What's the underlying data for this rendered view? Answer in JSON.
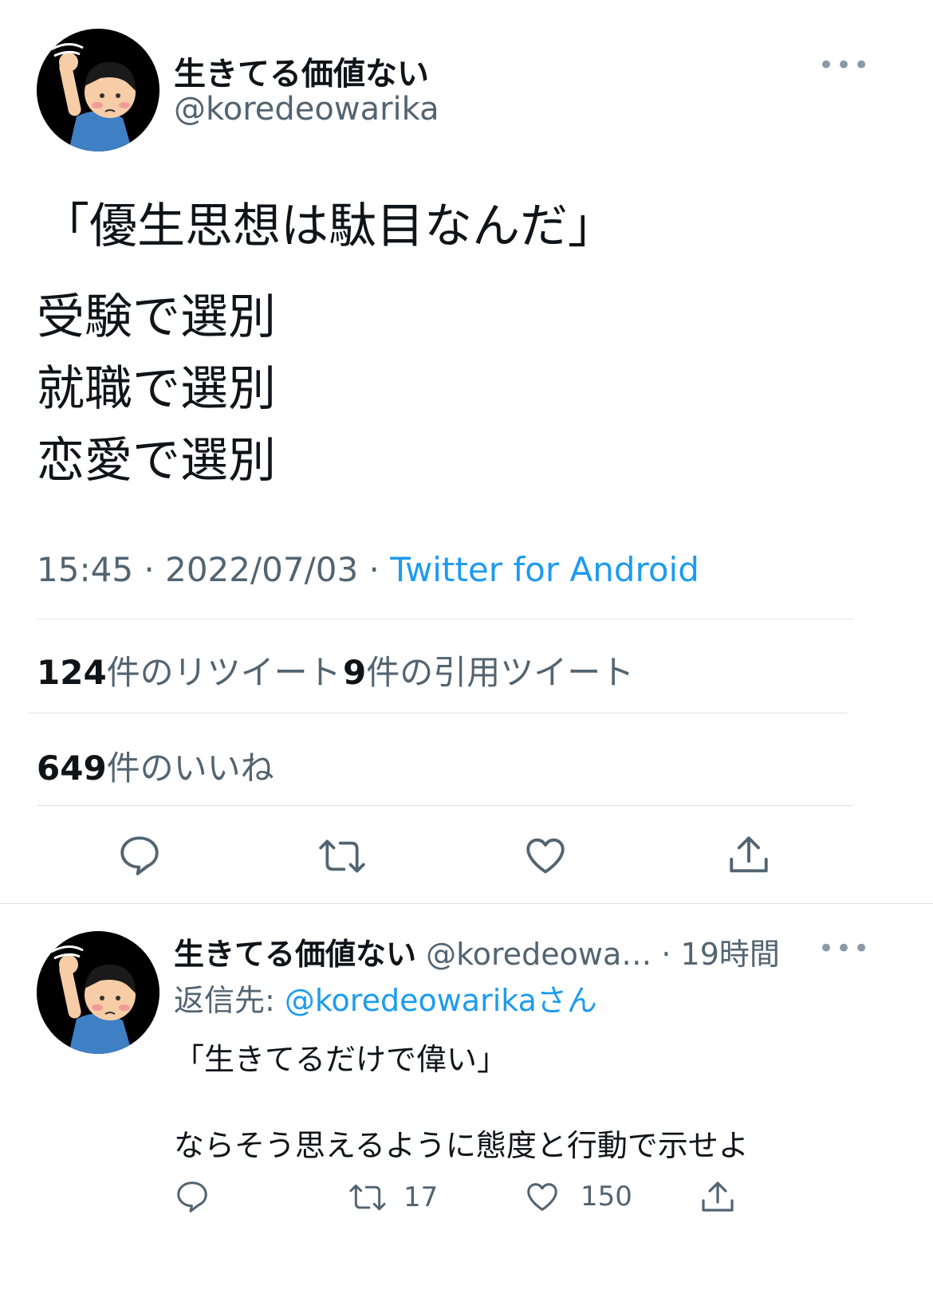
{
  "main_tweet": {
    "author_name": "生きてる価値ない",
    "author_handle": "@koredeowarika",
    "more_label": "•••",
    "lines": [
      "「優生思想は駄目なんだ」",
      "受験で選別",
      "就職で選別",
      "恋愛で選別"
    ],
    "time": "15:45",
    "date": "2022/07/03",
    "separator": " · ",
    "source": "Twitter for Android",
    "retweets_count": "124",
    "retweets_label": "件のリツイート",
    "quotes_count": "9",
    "quotes_label": "件の引用ツイート",
    "likes_count": "649",
    "likes_label": "件のいいね"
  },
  "reply_tweet": {
    "author_name": "生きてる価値ない",
    "author_handle": "@koredeowa…",
    "age": " · 19時間",
    "more_label": "•••",
    "reply_to_prefix": "返信先: ",
    "reply_to_handle": "@koredeowarika",
    "reply_to_suffix": "さん",
    "line1": "「生きてるだけで偉い」",
    "line2": "ならそう思えるように態度と行動で示せよ",
    "retweet_count": "17",
    "like_count": "150"
  },
  "icons": {
    "reply": "reply-icon",
    "retweet": "retweet-icon",
    "like": "heart-icon",
    "share": "share-icon",
    "more": "more-icon"
  },
  "colors": {
    "link": "#1d9bf0",
    "secondary_text": "#536471",
    "primary_text": "#0f1419"
  }
}
